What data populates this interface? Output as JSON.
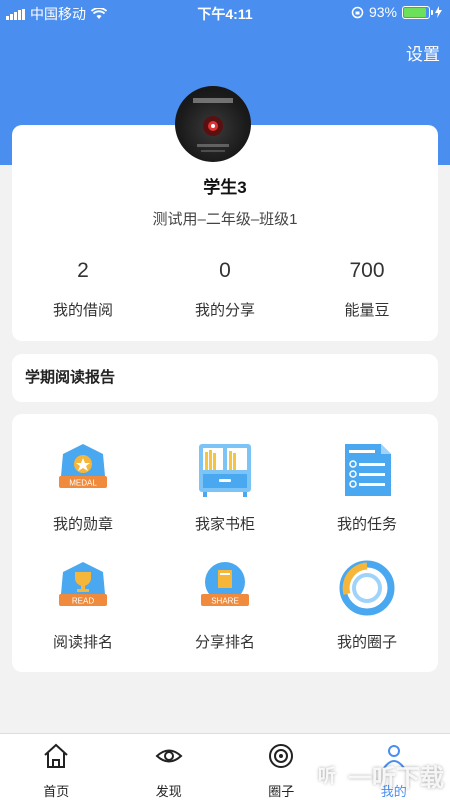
{
  "status_bar": {
    "carrier": "中国移动",
    "time": "下午4:11",
    "battery": "93%"
  },
  "header": {
    "settings_label": "设置"
  },
  "profile": {
    "name": "学生3",
    "class": "测试用–二年级–班级1",
    "stats": [
      {
        "value": "2",
        "label": "我的借阅"
      },
      {
        "value": "0",
        "label": "我的分享"
      },
      {
        "value": "700",
        "label": "能量豆"
      }
    ]
  },
  "report": {
    "title": "学期阅读报告"
  },
  "grid": {
    "items": [
      {
        "label": "我的勋章",
        "icon": "medal-icon",
        "badge_text": "MEDAL"
      },
      {
        "label": "我家书柜",
        "icon": "bookshelf-icon"
      },
      {
        "label": "我的任务",
        "icon": "task-list-icon"
      },
      {
        "label": "阅读排名",
        "icon": "reading-rank-icon",
        "badge_text": "READ"
      },
      {
        "label": "分享排名",
        "icon": "share-rank-icon",
        "badge_text": "SHARE"
      },
      {
        "label": "我的圈子",
        "icon": "circle-group-icon"
      }
    ]
  },
  "tabbar": {
    "tabs": [
      {
        "label": "首页",
        "icon": "home-icon"
      },
      {
        "label": "发现",
        "icon": "eye-icon"
      },
      {
        "label": "圈子",
        "icon": "circle-icon"
      },
      {
        "label": "我的",
        "icon": "person-icon",
        "active": true
      }
    ]
  },
  "watermark": {
    "text": "一听下载",
    "box_glyph": "听"
  },
  "colors": {
    "accent": "#4a8fef",
    "background": "#f2f2f2",
    "card": "#ffffff"
  }
}
